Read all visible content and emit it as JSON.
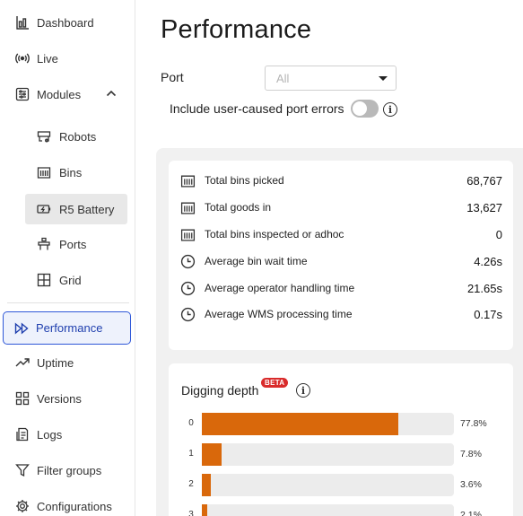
{
  "sidebar": {
    "items": [
      {
        "label": "Dashboard",
        "icon": "bar-chart-icon"
      },
      {
        "label": "Live",
        "icon": "broadcast-icon"
      },
      {
        "label": "Modules",
        "icon": "modules-icon",
        "expanded": true
      },
      {
        "label": "Performance",
        "icon": "fast-forward-icon",
        "active": true
      },
      {
        "label": "Uptime",
        "icon": "trend-up-icon"
      },
      {
        "label": "Versions",
        "icon": "grid-icon"
      },
      {
        "label": "Logs",
        "icon": "logs-icon"
      },
      {
        "label": "Filter groups",
        "icon": "filter-icon"
      },
      {
        "label": "Configurations",
        "icon": "gear-icon"
      }
    ],
    "modules": [
      {
        "label": "Robots",
        "icon": "robot-icon"
      },
      {
        "label": "Bins",
        "icon": "bins-icon"
      },
      {
        "label": "R5 Battery",
        "icon": "battery-icon",
        "selected": true
      },
      {
        "label": "Ports",
        "icon": "port-icon"
      },
      {
        "label": "Grid",
        "icon": "grid-square-icon"
      }
    ]
  },
  "main": {
    "title": "Performance",
    "port_label": "Port",
    "port_select_value": "All",
    "errors_toggle_label": "Include user-caused port errors",
    "errors_toggle_on": false
  },
  "stats": [
    {
      "label": "Total bins picked",
      "value": "68,767",
      "icon": "bins-icon"
    },
    {
      "label": "Total goods in",
      "value": "13,627",
      "icon": "bins-icon"
    },
    {
      "label": "Total bins inspected or adhoc",
      "value": "0",
      "icon": "bins-icon"
    },
    {
      "label": "Average bin wait time",
      "value": "4.26s",
      "icon": "clock-icon"
    },
    {
      "label": "Average operator handling time",
      "value": "21.65s",
      "icon": "clock-icon"
    },
    {
      "label": "Average WMS processing time",
      "value": "0.17s",
      "icon": "clock-icon"
    }
  ],
  "digging": {
    "title": "Digging depth",
    "badge": "BETA",
    "bar_color": "#d9680b"
  },
  "chart_data": {
    "type": "bar",
    "orientation": "horizontal",
    "categories": [
      "0",
      "1",
      "2",
      "3"
    ],
    "values": [
      77.8,
      7.8,
      3.6,
      2.1
    ],
    "value_labels": [
      "77.8%",
      "7.8%",
      "3.6%",
      "2.1%"
    ],
    "xlim": [
      0,
      100
    ],
    "title": "Digging depth"
  }
}
